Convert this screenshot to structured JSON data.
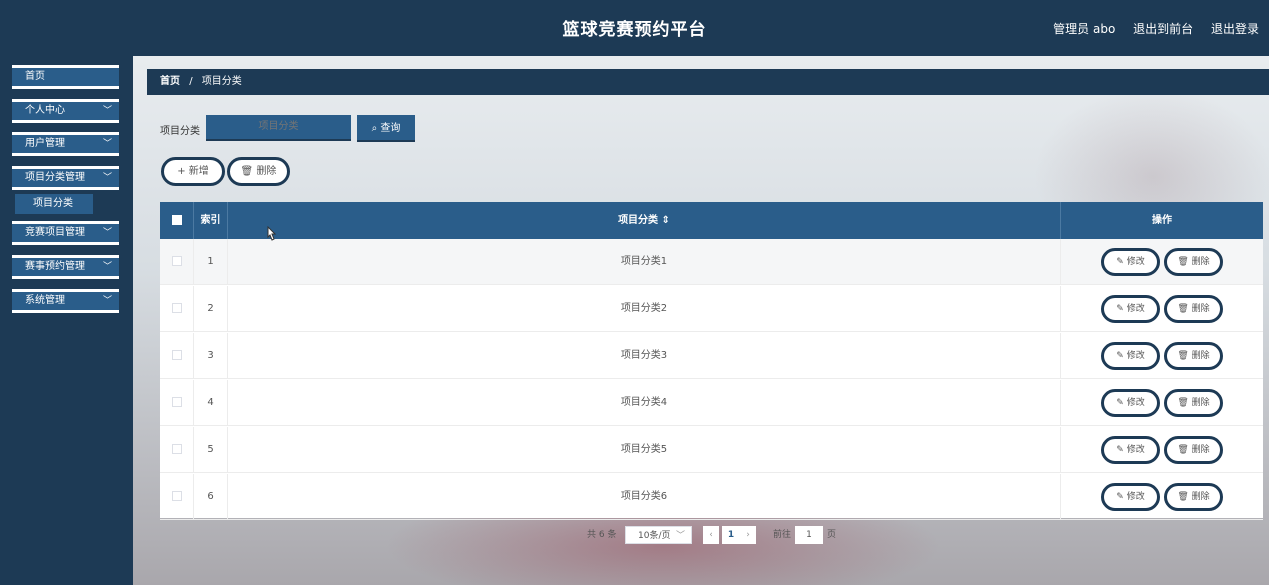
{
  "header": {
    "title": "篮球竞赛预约平台",
    "user": "管理员 abo",
    "to_front": "退出到前台",
    "logout": "退出登录"
  },
  "sidebar": {
    "items": [
      {
        "label": "首页"
      },
      {
        "label": "个人中心"
      },
      {
        "label": "用户管理"
      },
      {
        "label": "项目分类管理"
      },
      {
        "label": "竞赛项目管理"
      },
      {
        "label": "赛事预约管理"
      },
      {
        "label": "系统管理"
      }
    ],
    "sub_active": "项目分类"
  },
  "breadcrumb": {
    "home": "首页",
    "sep": "/",
    "current": "项目分类"
  },
  "search": {
    "label": "项目分类",
    "placeholder": "项目分类",
    "button": "查询"
  },
  "actions": {
    "add": "新增",
    "delete": "删除"
  },
  "table": {
    "headers": {
      "index": "索引",
      "name": "项目分类",
      "sort_icon": "⇕",
      "ops": "操作"
    },
    "edit_label": "修改",
    "delete_label": "删除",
    "rows": [
      {
        "index": "1",
        "name": "项目分类1"
      },
      {
        "index": "2",
        "name": "项目分类2"
      },
      {
        "index": "3",
        "name": "项目分类3"
      },
      {
        "index": "4",
        "name": "项目分类4"
      },
      {
        "index": "5",
        "name": "项目分类5"
      },
      {
        "index": "6",
        "name": "项目分类6"
      }
    ]
  },
  "pagination": {
    "total": "共 6 条",
    "page_size": "10条/页",
    "current_page": "1",
    "goto_label": "前往",
    "goto_value": "1",
    "page_suffix": "页"
  }
}
